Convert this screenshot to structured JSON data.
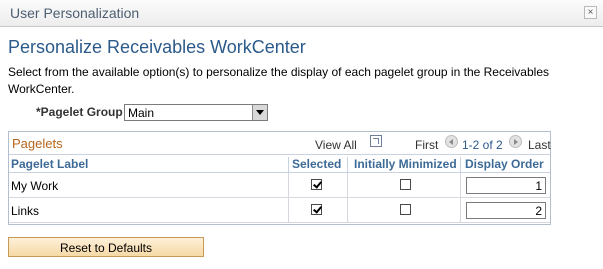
{
  "window": {
    "title": "User Personalization",
    "close_glyph": "×"
  },
  "page": {
    "title": "Personalize Receivables WorkCenter",
    "instructions": "Select from the available option(s) to personalize the display of each pagelet group in the Receivables WorkCenter."
  },
  "pagelet_group": {
    "label": "*Pagelet Group",
    "value": "Main"
  },
  "grid": {
    "title": "Pagelets",
    "view_all": "View All",
    "first": "First",
    "count": "1-2 of 2",
    "last": "Last",
    "columns": {
      "label": "Pagelet Label",
      "selected": "Selected",
      "minimized": "Initially Minimized",
      "order": "Display Order"
    },
    "rows": [
      {
        "label": "My Work",
        "selected": true,
        "minimized": false,
        "order": "1"
      },
      {
        "label": "Links",
        "selected": true,
        "minimized": false,
        "order": "2"
      }
    ]
  },
  "buttons": {
    "reset": "Reset to Defaults"
  },
  "icons": {
    "zoom": "grid-zoom-icon",
    "prev": "prev-arrow-icon",
    "next": "next-arrow-icon"
  }
}
